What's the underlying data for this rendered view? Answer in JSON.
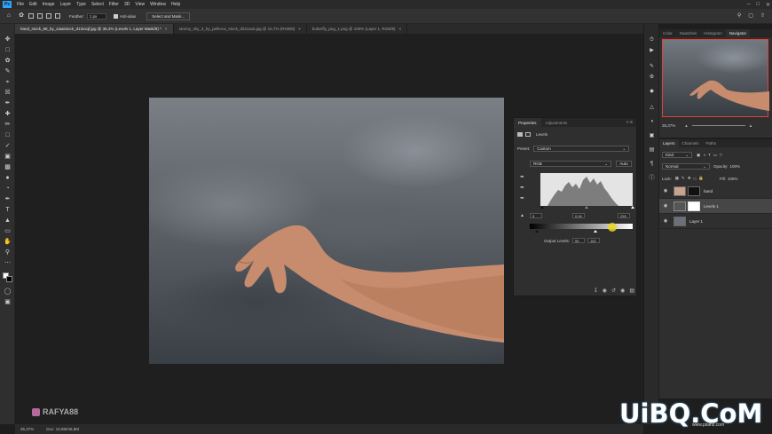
{
  "menubar": {
    "logo": "Ps",
    "items": [
      "File",
      "Edit",
      "Image",
      "Layer",
      "Type",
      "Select",
      "Filter",
      "3D",
      "View",
      "Window",
      "Help"
    ]
  },
  "options": {
    "feather_label": "Feather:",
    "feather_value": "1 px",
    "antialias_label": "Anti-alias",
    "select_mask_label": "Select and Mask..."
  },
  "tabs": [
    {
      "label": "hand_stock_68_by_xiaaistock_d13vxqf.jpg @ 35,4% (Levels 1, Layer Mask/8) *",
      "active": true
    },
    {
      "label": "stormy_sky_3_by_pellerox_stock_d22cax6.jpg @ 16,7% (RGB/8)",
      "active": false
    },
    {
      "label": "butterfly_png_1.png @ 100% (Layer 1, RGB/8)",
      "active": false
    }
  ],
  "properties": {
    "tabs": [
      "Properties",
      "Adjustments"
    ],
    "adjustment_name": "Levels",
    "preset_label": "Preset:",
    "preset_value": "Custom",
    "channel_value": "RGB",
    "auto_label": "Auto",
    "input_black": "5",
    "input_gamma": "0.94",
    "input_white": "255",
    "output_label": "Output Levels:",
    "output_black": "55",
    "output_white": "182"
  },
  "right": {
    "top_tabs": [
      "Color",
      "Swatches",
      "Histogram",
      "Navigator"
    ],
    "zoom_value": "35,37%",
    "layer_tabs": [
      "Layers",
      "Channels",
      "Paths"
    ],
    "kind_label": "Kind",
    "blend_mode": "Normal",
    "opacity_label": "Opacity:",
    "opacity_value": "100%",
    "lock_label": "Lock:",
    "fill_label": "Fill:",
    "fill_value": "100%",
    "layers": [
      {
        "name": "hand",
        "selected": false
      },
      {
        "name": "Levels 1",
        "selected": true
      },
      {
        "name": "Layer 1",
        "selected": false
      }
    ]
  },
  "status": {
    "zoom": "35,37%",
    "doc": "Doc: 10,9M/48,8M"
  },
  "watermark": {
    "handle": "RAFYA88",
    "brand": "UiBQ.CoM",
    "sub": "www.psahz.com"
  }
}
